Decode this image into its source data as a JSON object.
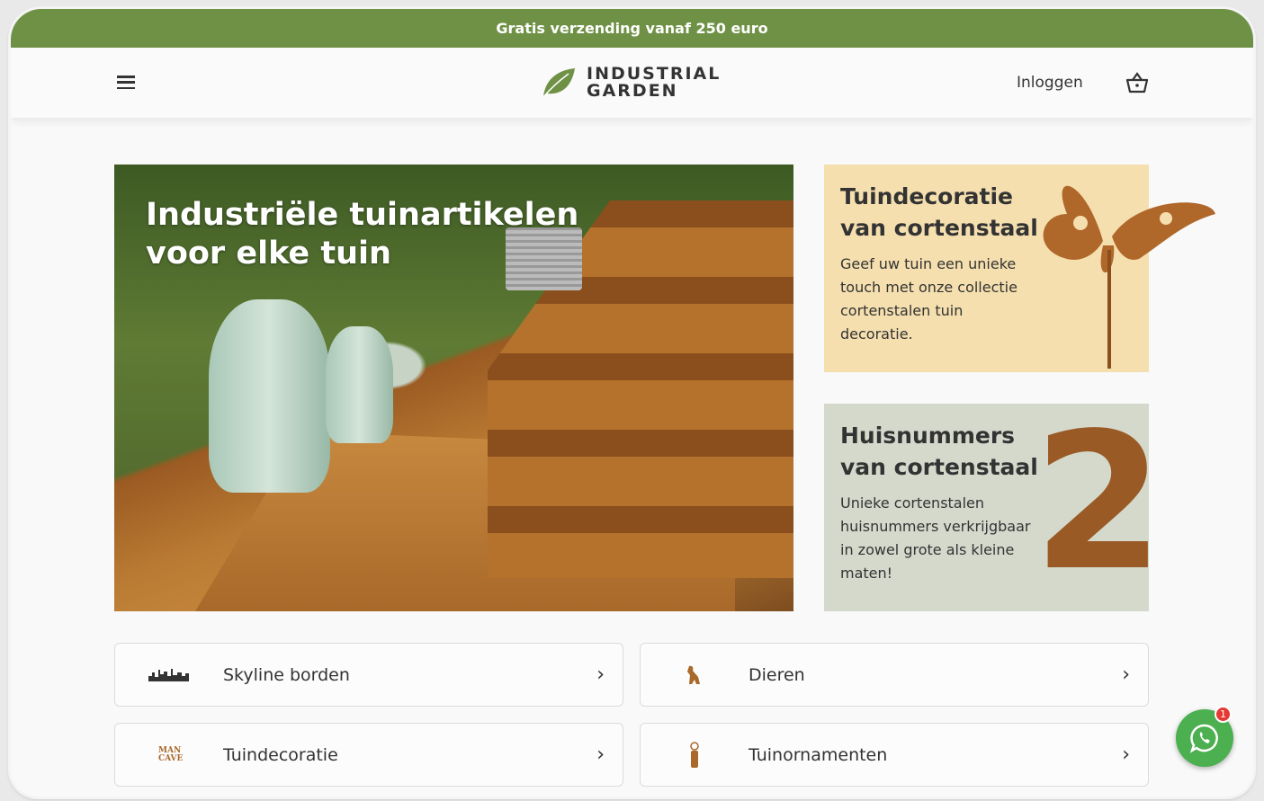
{
  "topbar": {
    "text": "Gratis verzending vanaf 250 euro"
  },
  "header": {
    "logo_line1": "INDUSTRIAL",
    "logo_line2": "GARDEN",
    "login": "Inloggen"
  },
  "hero": {
    "title_line1": "Industriële tuinartikelen",
    "title_line2": "voor elke tuin"
  },
  "promos": [
    {
      "title_line1": "Tuindecoratie",
      "title_line2": "van cortenstaal",
      "text": "Geef uw tuin een unieke touch met onze collectie cortenstalen tuin decoratie."
    },
    {
      "title_line1": "Huisnummers",
      "title_line2": "van cortenstaal",
      "text": "Unieke cortenstalen huisnummers verkrijgbaar in zowel grote als kleine maten!",
      "number": "2"
    }
  ],
  "categories": [
    {
      "label": "Skyline borden"
    },
    {
      "label": "Dieren"
    },
    {
      "label": "Tuindecoratie",
      "icon_text": "MAN CAVE"
    },
    {
      "label": "Tuinornamenten"
    }
  ],
  "whatsapp": {
    "badge": "1"
  },
  "colors": {
    "brand": "#6f9145",
    "corten": "#a8692a"
  }
}
